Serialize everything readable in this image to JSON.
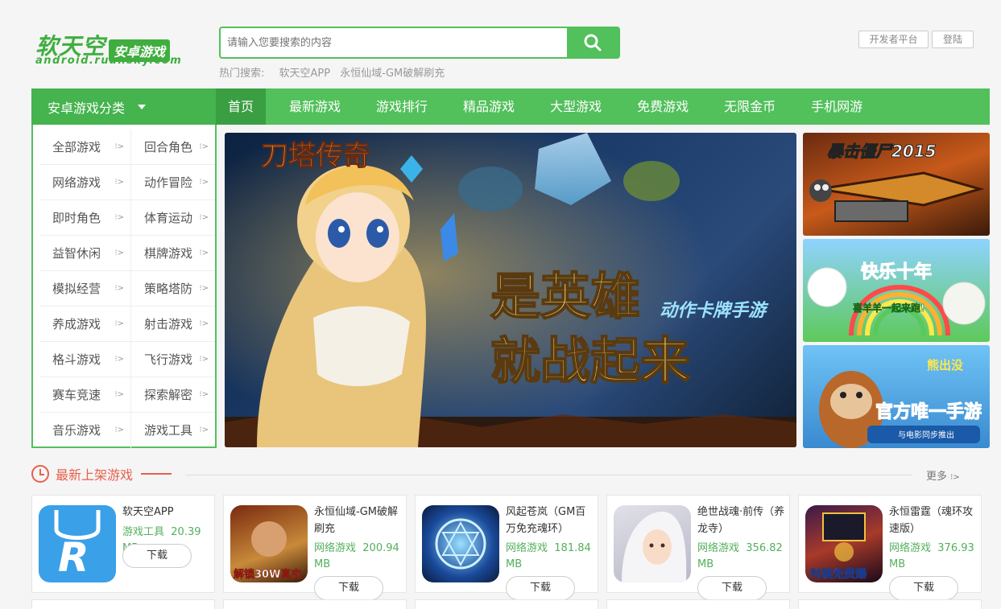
{
  "logo": {
    "cn_main": "软天空",
    "cn_sub": "安卓游戏",
    "en": "android.ruansky.com"
  },
  "search": {
    "placeholder": "请输入您要搜索的内容",
    "hot_label": "热门搜索:",
    "hot_items": [
      "软天空APP",
      "永恒仙域-GM破解刷充"
    ]
  },
  "top_buttons": {
    "dev": "开发者平台",
    "login": "登陆"
  },
  "nav": {
    "category_label": "安卓游戏分类",
    "items": [
      "首页",
      "最新游戏",
      "游戏排行",
      "精品游戏",
      "大型游戏",
      "免费游戏",
      "无限金币",
      "手机网游"
    ]
  },
  "sidebar": {
    "items": [
      "全部游戏",
      "回合角色",
      "网络游戏",
      "动作冒险",
      "即时角色",
      "体育运动",
      "益智休闲",
      "棋牌游戏",
      "模拟经营",
      "策略塔防",
      "养成游戏",
      "射击游戏",
      "格斗游戏",
      "飞行游戏",
      "赛车竞速",
      "探索解密",
      "音乐游戏",
      "游戏工具"
    ]
  },
  "hero": {
    "logo_text": "刀塔传奇",
    "slogan1": "是英雄",
    "slogan2": "就战起来",
    "tag": "动作卡牌手游"
  },
  "thumbs": [
    {
      "text": "暴击僵尸2015"
    },
    {
      "text": "快乐十年",
      "sub": "喜羊羊一起来跑!"
    },
    {
      "text": "熊出没",
      "main": "官方唯一手游",
      "sub": "与电影同步推出"
    }
  ],
  "section": {
    "title": "最新上架游戏",
    "more": "更多"
  },
  "cards": [
    {
      "name": "软天空APP",
      "category": "游戏工具",
      "size": "20.39 MB",
      "button": "下载"
    },
    {
      "name": "永恒仙域-GM破解刷充",
      "category": "网络游戏",
      "size": "200.94 MB",
      "button": "下载",
      "icon_text": "解锁30W真充"
    },
    {
      "name": "风起苍岚（GM百万免充魂环）",
      "category": "网络游戏",
      "size": "181.84 MB",
      "button": "下载"
    },
    {
      "name": "绝世战魂·前传（养龙寺）",
      "category": "网络游戏",
      "size": "356.82 MB",
      "button": "下载"
    },
    {
      "name": "永恒雷霆（魂环攻速版）",
      "category": "网络游戏",
      "size": "376.93 MB",
      "button": "下载",
      "icon_text": "时装免费爆"
    }
  ],
  "colors": {
    "brand": "#52c05b",
    "accent": "#e8604c"
  }
}
